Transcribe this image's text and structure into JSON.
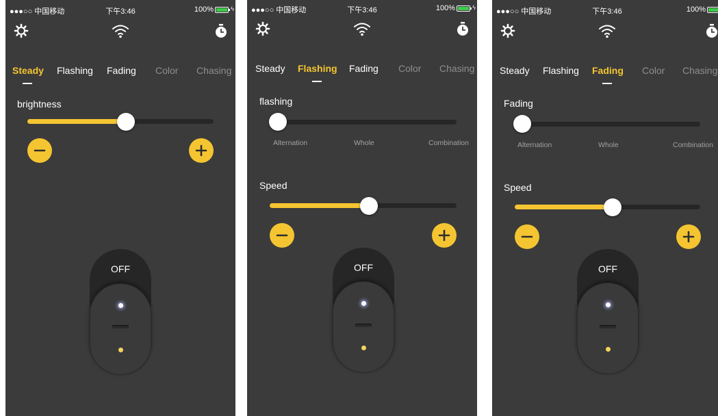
{
  "accent_color": "#f5c531",
  "status": {
    "carrier": "●●●○○ 中国移动",
    "time": "下午3:46",
    "battery": "100%"
  },
  "icons": [
    "settings-gear-icon",
    "wifi-icon",
    "timer-icon"
  ],
  "tabs": [
    "Steady",
    "Flashing",
    "Fading",
    "Color",
    "Chasing"
  ],
  "screens": [
    {
      "active_tab": "Steady",
      "slider_label": "brightness",
      "brightness_level": 0.53,
      "power_label": "OFF"
    },
    {
      "active_tab": "Flashing",
      "mode_label": "flashing",
      "mode_options": [
        "Alternation",
        "Whole",
        "Combination"
      ],
      "selected_mode": "Alternation",
      "speed_label": "Speed",
      "speed_level": 0.53,
      "power_label": "OFF"
    },
    {
      "active_tab": "Fading",
      "mode_label": "Fading",
      "mode_options": [
        "Alternation",
        "Whole",
        "Combination"
      ],
      "selected_mode": "Alternation",
      "speed_label": "Speed",
      "speed_level": 0.53,
      "power_label": "OFF"
    }
  ]
}
